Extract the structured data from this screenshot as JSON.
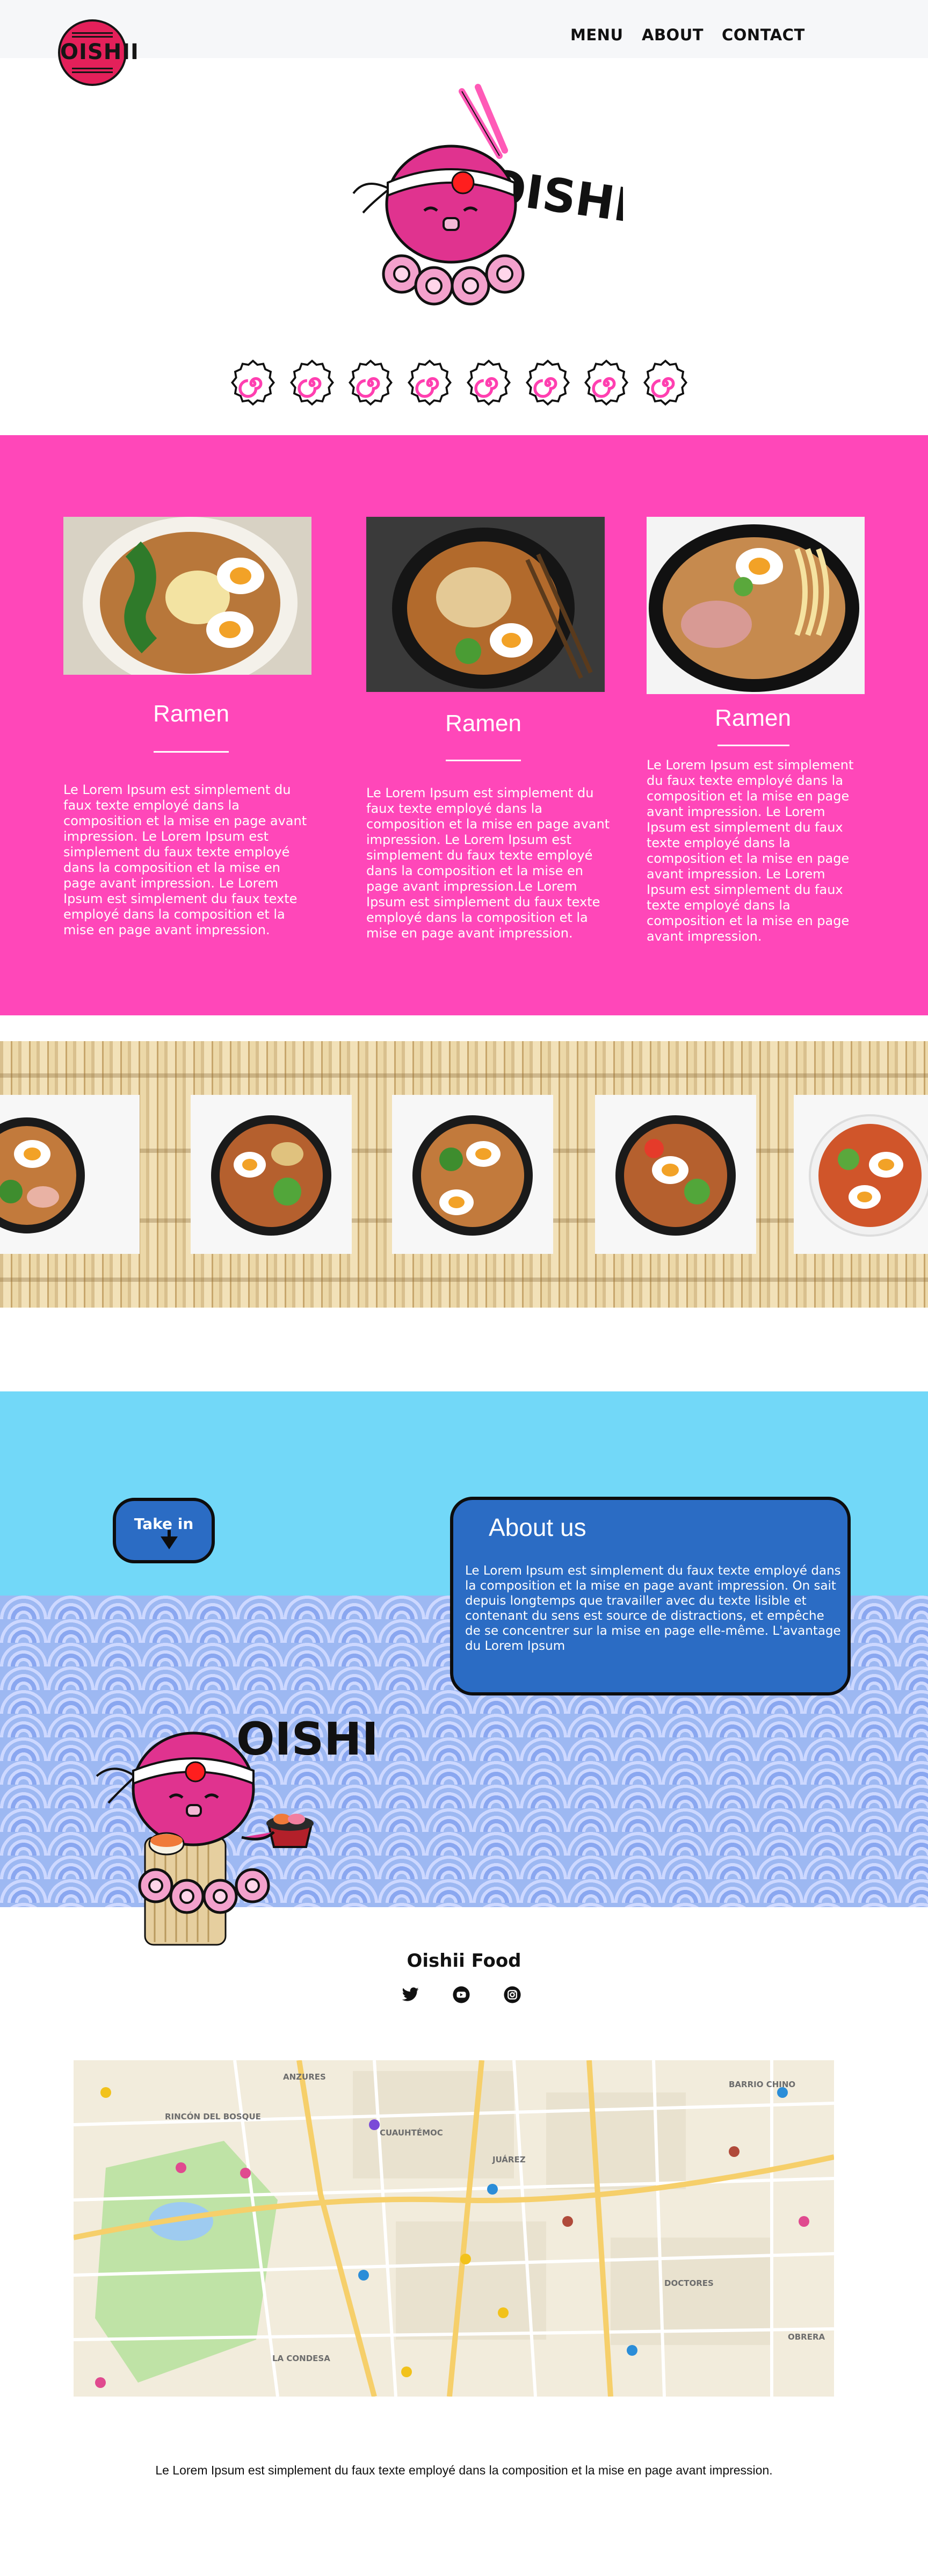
{
  "nav": {
    "logo_text": "OISHII",
    "links": [
      "MENU",
      "ABOUT",
      "CONTACT"
    ]
  },
  "hero": {
    "brand_text": "OISHII",
    "naruto_count": 8
  },
  "cards": [
    {
      "title": "Ramen",
      "text": "Le Lorem Ipsum est simplement du faux texte employé dans la composition et la mise en page avant impression.  Le Lorem Ipsum est simplement du faux texte employé dans la composition et la mise en page avant impression. Le Lorem Ipsum est simplement du faux texte employé dans la composition et la mise en page avant impression."
    },
    {
      "title": "Ramen",
      "text": "Le Lorem Ipsum est simplement du faux texte employé dans la composition et la mise en page avant impression. Le Lorem Ipsum est simplement du faux texte employé dans la composition et la mise en page avant impression.Le Lorem Ipsum est simplement du faux texte employé dans la composition et la mise en page avant impression."
    },
    {
      "title": "Ramen",
      "text": "Le Lorem Ipsum est simplement du faux texte employé dans la composition et la mise en page avant impression. Le Lorem Ipsum est simplement du faux texte employé dans la composition et la mise en page avant impression. Le Lorem Ipsum est simplement du faux texte employé dans la composition et la mise en page avant impression."
    }
  ],
  "take_in": {
    "label": "Take in"
  },
  "about": {
    "title": "About us",
    "text": "Le Lorem Ipsum est simplement du faux texte employé dans la composition et la mise en page avant impression.  On sait depuis longtemps que travailler avec du texte lisible et contenant du sens est source de distractions, et empêche de se concentrer sur la mise en page elle-même. L'avantage du Lorem Ipsum"
  },
  "mascot2": {
    "brand_text": "OISHII"
  },
  "footer": {
    "title": "Oishii Food",
    "social": [
      "twitter-icon",
      "youtube-icon",
      "instagram-icon"
    ],
    "text": "Le Lorem Ipsum est simplement du faux texte employé dans la composition et la mise en page avant impression."
  },
  "map": {
    "labels": [
      "ANZURES",
      "CUAUHTÉMOC",
      "BARRIO CHINO",
      "RINCÓN DEL BOSQUE",
      "JUÁREZ",
      "DOCTORES",
      "LA CONDESA",
      "OBRERA"
    ]
  },
  "colors": {
    "pink": "#ff47b9",
    "sky": "#72d8f8",
    "blue_box": "#2b6cc4",
    "logo_red": "#e4205a"
  }
}
